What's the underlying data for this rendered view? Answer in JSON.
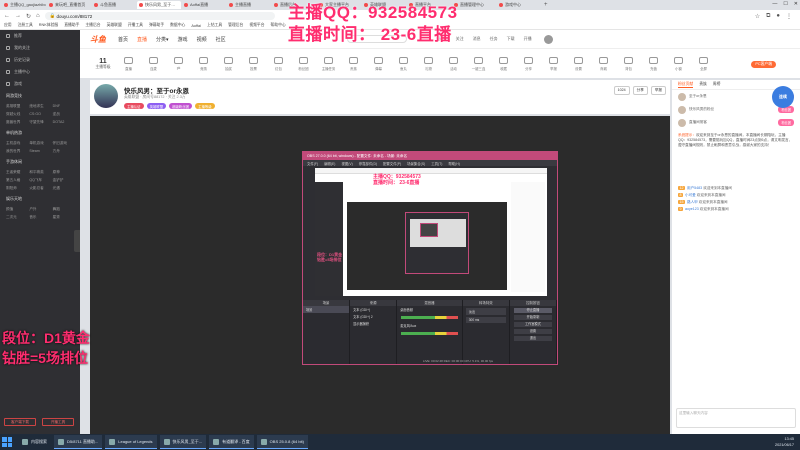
{
  "browser": {
    "tabs": [
      {
        "label": "主播QQ_gaojiazhibo",
        "active": false
      },
      {
        "label": "来玩吧_直播首页",
        "active": false
      },
      {
        "label": "斗鱼直播",
        "active": false
      },
      {
        "label": "快乐风男_至于…",
        "active": true
      },
      {
        "label": "Aoffai直播",
        "active": false
      },
      {
        "label": "主播直播",
        "active": false
      },
      {
        "label": "直播后台",
        "active": false
      },
      {
        "label": "大家主播平台",
        "active": false
      },
      {
        "label": "英雄联盟",
        "active": false
      },
      {
        "label": "直播平台",
        "active": false
      },
      {
        "label": "直播管理中心",
        "active": false
      },
      {
        "label": "游戏中心",
        "active": false
      }
    ],
    "url": "douyu.com/88172",
    "bookmarks": [
      "应用",
      "注册工具",
      "RNK体验服",
      "直播助手",
      "主播后台",
      "英雄联盟",
      "开播工具",
      "弹幕助手",
      "数据中心",
      "Aoffai",
      "上钻工具",
      "管理后台",
      "视频平台",
      "帮助中心"
    ]
  },
  "overlay": {
    "qq": "主播QQ：932584573",
    "time": "直播时间：  23-6直播",
    "rank1": "段位：D1黄金",
    "rank2": "钻胜=5场排位"
  },
  "site": {
    "logo": "斗鱼",
    "nav": [
      "首页",
      "直播",
      "分类▾",
      "游戏",
      "视频",
      "社区"
    ],
    "nav_active": "直播",
    "head_icons": [
      "历史",
      "关注",
      "消息",
      "任务",
      "下载",
      "开播"
    ]
  },
  "sidebar": {
    "top_items": [
      "推荐",
      "我的关注",
      "历史记录",
      "主播中心",
      "游戏"
    ],
    "sections": [
      {
        "title": "网游竞技",
        "items": [
          "英雄联盟",
          "绝地求生",
          "DNF",
          "穿越火线",
          "CS:GO",
          "逆战",
          "魔兽世界",
          "守望先锋",
          "DOTA2"
        ]
      },
      {
        "title": "单机热游",
        "items": [
          "主机游戏",
          "单机游戏",
          "怀旧游戏",
          "我的世界",
          "Steam",
          "方舟"
        ]
      },
      {
        "title": "手游休闲",
        "items": [
          "王者荣耀",
          "和平精英",
          "原神",
          "第五人格",
          "QQ飞车",
          "金铲铲",
          "阴阳师",
          "火影忍者",
          "光遇"
        ]
      },
      {
        "title": "娱乐天地",
        "items": [
          "颜值",
          "户外",
          "舞蹈",
          "二次元",
          "音乐",
          "星秀"
        ]
      }
    ],
    "buttons": [
      "客户端下载",
      "开播工具"
    ]
  },
  "toolbar": {
    "rank_num": "11",
    "rank_label": "主播等级",
    "tools": [
      "直播",
      "连麦",
      "pk",
      "竞猜",
      "抽奖",
      "投票",
      "红包",
      "粉丝团",
      "主播任务",
      "贵族",
      "弹幕",
      "鱼丸",
      "礼物",
      "活动",
      "一键三连",
      "收藏",
      "分享",
      "举报",
      "设置",
      "商城",
      "背包",
      "充值",
      "小窗",
      "全屏"
    ],
    "pc_button": "PC客户端"
  },
  "room": {
    "title": "快乐风男：至于or永恩",
    "sub": "英雄联盟 · 房间号88172 · 关注 2.3万",
    "tags": [
      "主播认证",
      "英雄联盟",
      "超级粉丝团",
      "主播等级"
    ],
    "right": [
      "1024",
      "分享",
      "举报"
    ]
  },
  "obs": {
    "title": "OBS 27.0.0 (64 bit, windows) - 配置文件: 未命名 - 场景: 未命名",
    "menu": [
      "文件(F)",
      "编辑(E)",
      "视图(V)",
      "停靠部件(D)",
      "配置文件(P)",
      "场景集合(S)",
      "工具(T)",
      "帮助(H)"
    ],
    "docks": [
      "场景",
      "来源",
      "混音器",
      "转场特效",
      "控制按钮"
    ],
    "scene": "场景",
    "sources": [
      "文本 (GDI+)",
      "文本 (GDI+) 2",
      "显示器捕获"
    ],
    "mixer": [
      "桌面音频",
      "麦克风/Aux"
    ],
    "transition": "淡出",
    "duration": "300 ms",
    "controls": [
      "停止直播",
      "开始录制",
      "工作室模式",
      "设置",
      "退出"
    ],
    "status": "LIVE: 00:02:48  REC: 00:00:00  CPU: 5.1%, 30.00 fps"
  },
  "chat": {
    "tabs": [
      "粉丝贡献",
      "贵族",
      "周榜"
    ],
    "badge": "连续",
    "fans": [
      {
        "name": "至于or永恩",
        "btn": "粉丝团"
      },
      {
        "name": "快乐风男的粉丝",
        "btn": "粉丝团"
      },
      {
        "name": "直播间常客",
        "btn": "粉丝团"
      }
    ],
    "notice_head": "系统提示：",
    "notice": "欢迎来到至于or永恩的直播间，本直播间长期陪玩，主播QQ：932584573，需要陪玩加QQ，直播时间23点到6点，请文明发言，遵守直播间规则，禁止刷屏和恶意引战，感谢大家的支持！",
    "lines": [
      {
        "lvl": "12",
        "name": "用户5483",
        "text": "欢迎来到本直播间"
      },
      {
        "lvl": "8",
        "name": "小可爱",
        "text": "欢迎来到本直播间"
      },
      {
        "lvl": "15",
        "name": "路人甲",
        "text": "欢迎来到本直播间"
      },
      {
        "lvl": "9",
        "name": "aoye123",
        "text": "欢迎来到本直播间"
      }
    ],
    "input_placeholder": "这里输入聊天内容"
  },
  "taskbar": {
    "items": [
      {
        "label": "内容搜索",
        "open": false
      },
      {
        "label": "D5/8711 直播助...",
        "open": true
      },
      {
        "label": "League of Legends",
        "open": true
      },
      {
        "label": "快乐风男_至于...",
        "open": true
      },
      {
        "label": "有道翻译 - 百度",
        "open": true
      },
      {
        "label": "OBS 25.0.8 (64 bit)",
        "open": true
      }
    ],
    "clock": "13:45",
    "date": "2021/06/17"
  }
}
